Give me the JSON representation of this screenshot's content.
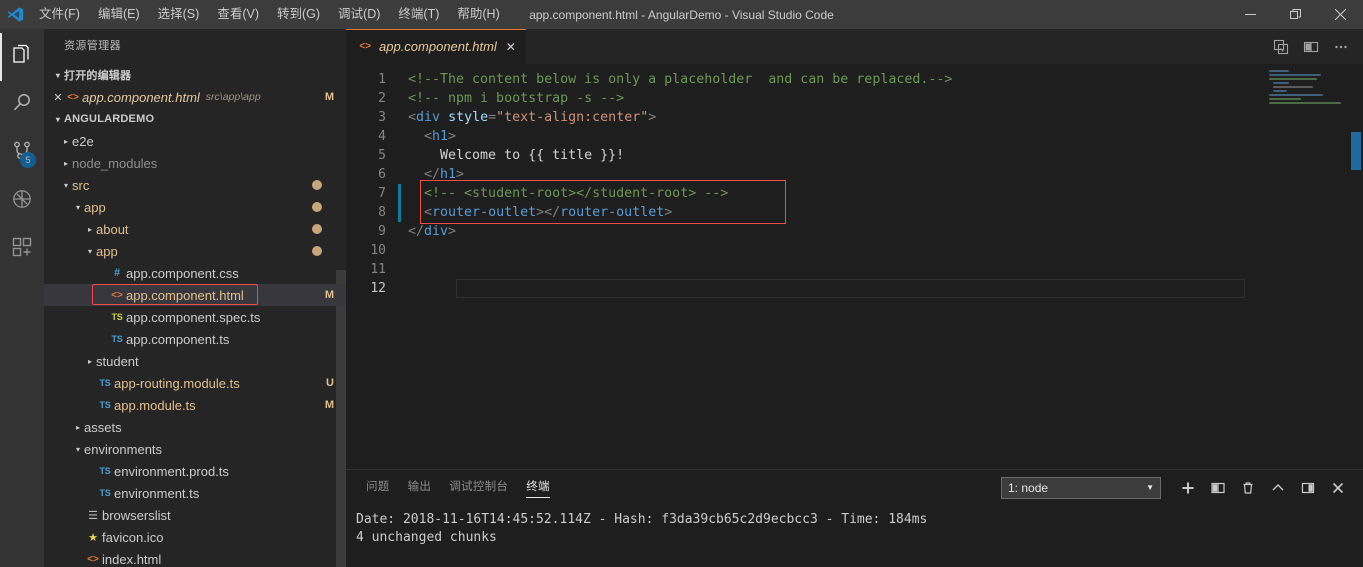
{
  "titlebar": {
    "title": "app.component.html - AngularDemo - Visual Studio Code",
    "menus": [
      {
        "label": "文件(F)",
        "name": "menu-file"
      },
      {
        "label": "编辑(E)",
        "name": "menu-edit"
      },
      {
        "label": "选择(S)",
        "name": "menu-selection"
      },
      {
        "label": "查看(V)",
        "name": "menu-view"
      },
      {
        "label": "转到(G)",
        "name": "menu-goto"
      },
      {
        "label": "调试(D)",
        "name": "menu-debug"
      },
      {
        "label": "终端(T)",
        "name": "menu-terminal"
      },
      {
        "label": "帮助(H)",
        "name": "menu-help"
      }
    ],
    "window_controls": {
      "minimize": "—",
      "restore": "❐",
      "close": "✕"
    }
  },
  "activitybar": {
    "items": [
      {
        "name": "explorer",
        "icon": "files-icon",
        "active": true
      },
      {
        "name": "search",
        "icon": "search-icon",
        "active": false
      },
      {
        "name": "source-control",
        "icon": "source-control-icon",
        "active": false,
        "badge": "5"
      },
      {
        "name": "debug",
        "icon": "debug-icon",
        "active": false
      },
      {
        "name": "extensions",
        "icon": "extensions-icon",
        "active": false
      }
    ]
  },
  "sidebar": {
    "title": "资源管理器",
    "open_editors": {
      "header": "打开的编辑器",
      "items": [
        {
          "close": "✕",
          "icon": "html-file-icon",
          "name": "app.component.html",
          "desc": "src\\app\\app",
          "badge": "M"
        }
      ]
    },
    "project": {
      "header": "ANGULARDEMO",
      "tree": [
        {
          "label": "e2e",
          "indent": 1,
          "arrow": "▸",
          "icon": "",
          "badge": "",
          "dot": false,
          "mod": false
        },
        {
          "label": "node_modules",
          "indent": 1,
          "arrow": "▸",
          "icon": "",
          "badge": "",
          "dot": false,
          "mod": false,
          "dim": true
        },
        {
          "label": "src",
          "indent": 1,
          "arrow": "▾",
          "icon": "",
          "badge": "",
          "dot": true,
          "mod": true
        },
        {
          "label": "app",
          "indent": 2,
          "arrow": "▾",
          "icon": "",
          "badge": "",
          "dot": true,
          "mod": true
        },
        {
          "label": "about",
          "indent": 3,
          "arrow": "▸",
          "icon": "",
          "badge": "",
          "dot": true,
          "mod": true
        },
        {
          "label": "app",
          "indent": 3,
          "arrow": "▾",
          "icon": "",
          "badge": "",
          "dot": true,
          "mod": true
        },
        {
          "label": "app.component.css",
          "indent": 4,
          "arrow": "",
          "icon": "css",
          "badge": "",
          "dot": false,
          "mod": false
        },
        {
          "label": "app.component.html",
          "indent": 4,
          "arrow": "",
          "icon": "html",
          "badge": "M",
          "dot": false,
          "mod": true,
          "selected": true
        },
        {
          "label": "app.component.spec.ts",
          "indent": 4,
          "arrow": "",
          "icon": "ts-spec",
          "badge": "",
          "dot": false,
          "mod": false
        },
        {
          "label": "app.component.ts",
          "indent": 4,
          "arrow": "",
          "icon": "ts",
          "badge": "",
          "dot": false,
          "mod": false
        },
        {
          "label": "student",
          "indent": 3,
          "arrow": "▸",
          "icon": "",
          "badge": "",
          "dot": false,
          "mod": false
        },
        {
          "label": "app-routing.module.ts",
          "indent": 3,
          "arrow": "",
          "icon": "ts",
          "badge": "U",
          "dot": false,
          "mod": true
        },
        {
          "label": "app.module.ts",
          "indent": 3,
          "arrow": "",
          "icon": "ts",
          "badge": "M",
          "dot": false,
          "mod": true
        },
        {
          "label": "assets",
          "indent": 2,
          "arrow": "▸",
          "icon": "",
          "badge": "",
          "dot": false,
          "mod": false
        },
        {
          "label": "environments",
          "indent": 2,
          "arrow": "▾",
          "icon": "",
          "badge": "",
          "dot": false,
          "mod": false
        },
        {
          "label": "environment.prod.ts",
          "indent": 3,
          "arrow": "",
          "icon": "ts",
          "badge": "",
          "dot": false,
          "mod": false
        },
        {
          "label": "environment.ts",
          "indent": 3,
          "arrow": "",
          "icon": "ts",
          "badge": "",
          "dot": false,
          "mod": false
        },
        {
          "label": "browserslist",
          "indent": 2,
          "arrow": "",
          "icon": "list",
          "badge": "",
          "dot": false,
          "mod": false
        },
        {
          "label": "favicon.ico",
          "indent": 2,
          "arrow": "",
          "icon": "star",
          "badge": "",
          "dot": false,
          "mod": false
        },
        {
          "label": "index.html",
          "indent": 2,
          "arrow": "",
          "icon": "html",
          "badge": "",
          "dot": false,
          "mod": false
        }
      ]
    }
  },
  "editor": {
    "tab": {
      "label": "app.component.html",
      "icon": "html-file-icon",
      "close": "✕"
    },
    "actions": [
      {
        "name": "open-preview-to-side-icon"
      },
      {
        "name": "split-editor-icon"
      },
      {
        "name": "more-actions-icon"
      }
    ],
    "line_numbers": [
      "1",
      "2",
      "3",
      "4",
      "5",
      "6",
      "7",
      "8",
      "9",
      "10",
      "11",
      "12"
    ],
    "active_line": 12,
    "lines": [
      [
        {
          "t": "com",
          "v": "<!--The content below is only a placeholder  and can be replaced.-->"
        }
      ],
      [
        {
          "t": "com",
          "v": "<!-- npm i bootstrap -s -->"
        }
      ],
      [
        {
          "t": "br",
          "v": "<"
        },
        {
          "t": "tag",
          "v": "div"
        },
        {
          "t": "txt",
          "v": " "
        },
        {
          "t": "att",
          "v": "style"
        },
        {
          "t": "br",
          "v": "="
        },
        {
          "t": "str",
          "v": "\"text-align:center\""
        },
        {
          "t": "br",
          "v": ">"
        }
      ],
      [
        {
          "t": "txt",
          "v": "  "
        },
        {
          "t": "br",
          "v": "<"
        },
        {
          "t": "tag",
          "v": "h1"
        },
        {
          "t": "br",
          "v": ">"
        }
      ],
      [
        {
          "t": "txt",
          "v": "    Welcome to {{ title }}!"
        }
      ],
      [
        {
          "t": "txt",
          "v": "  "
        },
        {
          "t": "br",
          "v": "</"
        },
        {
          "t": "tag",
          "v": "h1"
        },
        {
          "t": "br",
          "v": ">"
        }
      ],
      [
        {
          "t": "txt",
          "v": "  "
        },
        {
          "t": "com",
          "v": "<!-- <student-root></student-root> -->"
        }
      ],
      [
        {
          "t": "txt",
          "v": "  "
        },
        {
          "t": "br",
          "v": "<"
        },
        {
          "t": "tag",
          "v": "router-outlet"
        },
        {
          "t": "br",
          "v": "></"
        },
        {
          "t": "tag",
          "v": "router-outlet"
        },
        {
          "t": "br",
          "v": ">"
        }
      ],
      [
        {
          "t": "br",
          "v": "</"
        },
        {
          "t": "tag",
          "v": "div"
        },
        {
          "t": "br",
          "v": ">"
        }
      ],
      [],
      [],
      []
    ]
  },
  "panel": {
    "tabs": [
      {
        "label": "问题",
        "name": "panel-tab-problems",
        "active": false
      },
      {
        "label": "输出",
        "name": "panel-tab-output",
        "active": false
      },
      {
        "label": "调试控制台",
        "name": "panel-tab-debug-console",
        "active": false
      },
      {
        "label": "终端",
        "name": "panel-tab-terminal",
        "active": true
      }
    ],
    "terminal_select": {
      "value": "1: node",
      "caret": "▼"
    },
    "actions": [
      {
        "name": "new-terminal-icon"
      },
      {
        "name": "split-terminal-icon"
      },
      {
        "name": "kill-terminal-icon"
      },
      {
        "name": "maximize-panel-icon"
      },
      {
        "name": "toggle-panel-icon"
      },
      {
        "name": "close-panel-icon"
      }
    ],
    "terminal_lines": [
      "Date: 2018-11-16T14:45:52.114Z - Hash: f3da39cb65c2d9ecbcc3 - Time: 184ms",
      "4 unchanged chunks"
    ]
  },
  "colors": {
    "accent": "#007acc",
    "annotation": "#f14c4c",
    "modified": "#e2c08d",
    "comment": "#6a9955",
    "tag": "#569cd6",
    "attribute": "#9cdcfe",
    "string": "#ce9178"
  }
}
